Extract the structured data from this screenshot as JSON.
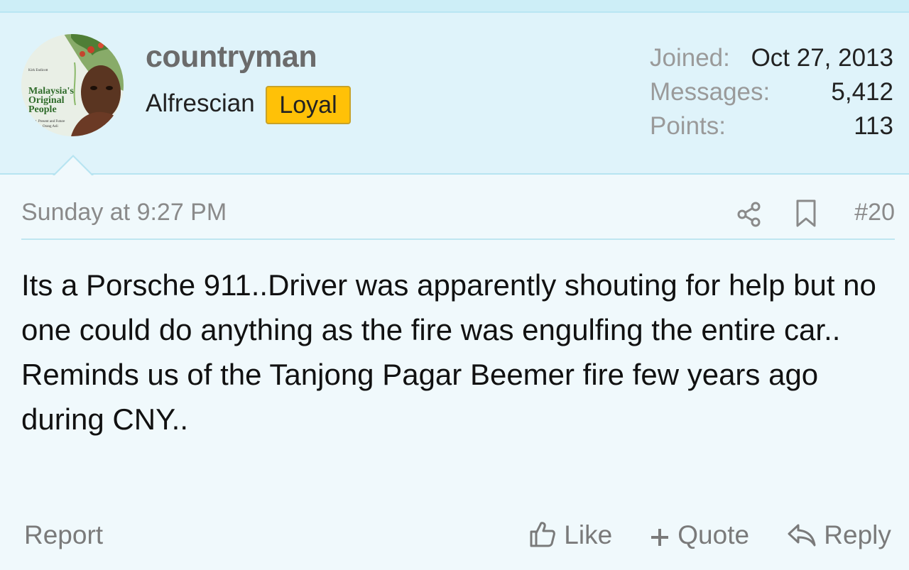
{
  "user": {
    "username": "countryman",
    "title": "Alfrescian",
    "badge": "Loyal",
    "avatar_text": {
      "line1": "Malaysia's",
      "line2": "Original",
      "line3": "People",
      "small1": "Kirk Endicott",
      "small2": "t, Present and Future",
      "small3": "Orang Asli"
    },
    "stats": [
      {
        "label": "Joined:",
        "value": "Oct 27, 2013"
      },
      {
        "label": "Messages:",
        "value": "5,412"
      },
      {
        "label": "Points:",
        "value": "113"
      }
    ]
  },
  "post": {
    "date": "Sunday at 9:27 PM",
    "number": "#20",
    "paragraphs": [
      "Its a Porsche 911..Driver was apparently shouting for help but no one could do anything as the fire was engulfing the entire car..",
      "Reminds us of the Tanjong Pagar Beemer fire few years ago during CNY.."
    ]
  },
  "actions": {
    "report": "Report",
    "like": "Like",
    "quote": "Quote",
    "reply": "Reply"
  },
  "icons": {
    "share": "share-icon",
    "bookmark": "bookmark-icon",
    "like": "thumbs-up-icon",
    "quote": "plus-icon",
    "reply": "reply-arrow-icon"
  },
  "colors": {
    "header_bg": "#dff3fa",
    "page_bg": "#f0f9fc",
    "badge": "#ffc107",
    "muted_text": "#8a8a8a"
  }
}
